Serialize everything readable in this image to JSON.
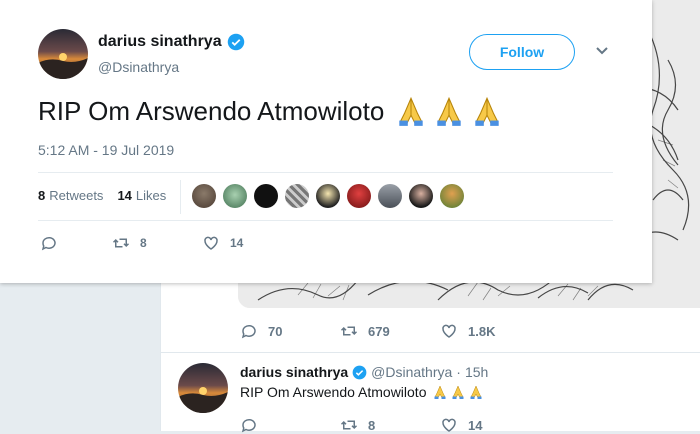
{
  "background_tweet": {
    "reply_count": "70",
    "retweet_count": "679",
    "like_count": "1.8K",
    "author_name": "darius sinathrya",
    "author_handle": "@Dsinathrya",
    "separator": "·",
    "time": "15h",
    "text": "RIP Om Arswendo Atmowiloto",
    "reply_count_2": "",
    "retweet_count_2": "8",
    "like_count_2": "14"
  },
  "tweet": {
    "author_name": "darius sinathrya",
    "author_handle": "@Dsinathrya",
    "follow_label": "Follow",
    "text": "RIP Om Arswendo Atmowiloto",
    "emojis": [
      "folded-hands",
      "folded-hands",
      "folded-hands"
    ],
    "timestamp": "5:12 AM - 19 Jul 2019",
    "retweets_count": "8",
    "retweets_label": "Retweets",
    "likes_count": "14",
    "likes_label": "Likes",
    "liker_avatars": 9,
    "actions": {
      "reply_count": "",
      "retweet_count": "8",
      "like_count": "14"
    }
  },
  "colors": {
    "accent": "#1da1f2",
    "text_secondary": "#657786",
    "verified": "#1da1f2"
  },
  "icons": [
    "reply-icon",
    "retweet-icon",
    "heart-icon",
    "verified-icon",
    "chevron-down-icon"
  ]
}
